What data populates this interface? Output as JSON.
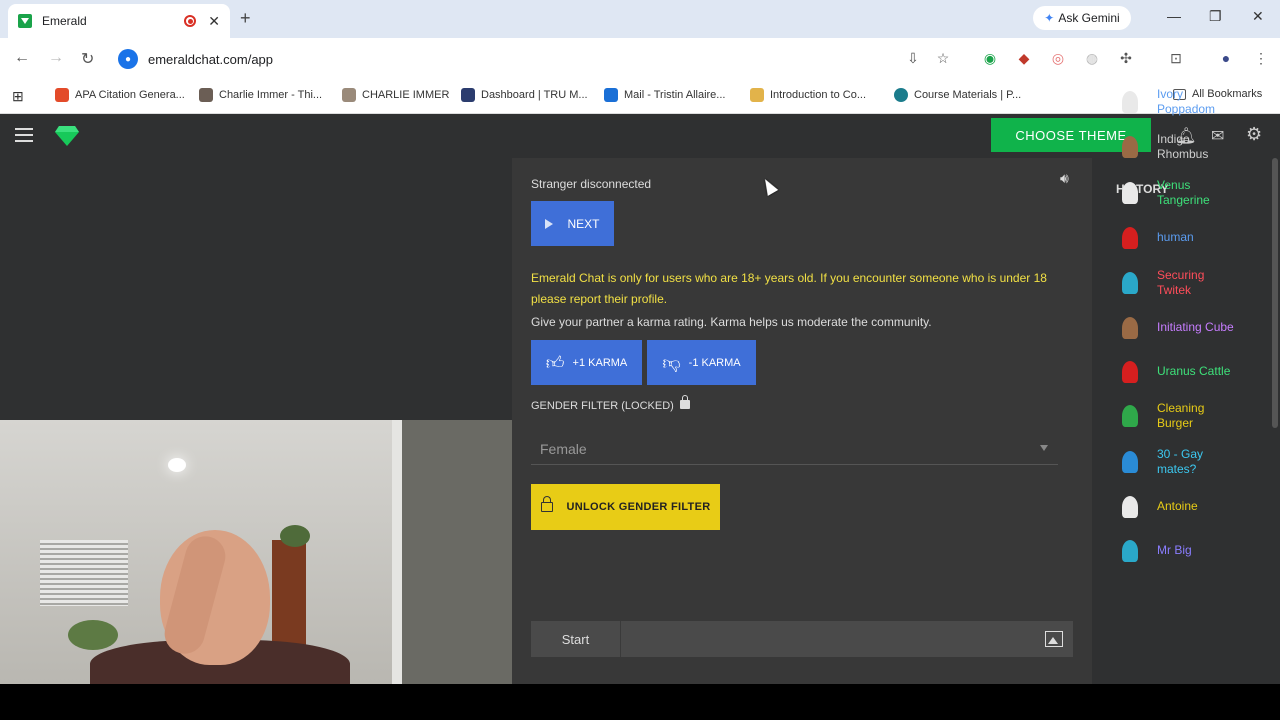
{
  "browser": {
    "tab_title": "Emerald",
    "new_tab": "+",
    "ask_gemini": "Ask Gemini",
    "url": "emeraldchat.com/app",
    "bookmarks": [
      {
        "label": "APA Citation Genera...",
        "color": "#e34b2a"
      },
      {
        "label": "Charlie Immer - Thi...",
        "color": "#6b5e55"
      },
      {
        "label": "CHARLIE IMMER",
        "color": "#9a8a7a"
      },
      {
        "label": "Dashboard | TRU M...",
        "color": "#2b3c6e"
      },
      {
        "label": "Mail - Tristin Allaire...",
        "color": "#1a6fd6"
      },
      {
        "label": "Introduction to Co...",
        "color": "#e2b34a"
      },
      {
        "label": "Course Materials | P...",
        "color": "#1b7c8c"
      }
    ],
    "all_bookmarks": "All Bookmarks"
  },
  "app": {
    "choose_theme": "CHOOSE THEME",
    "status": "Stranger disconnected",
    "next_label": "NEXT",
    "warning": "Emerald Chat is only for users who are 18+ years old. If you encounter someone who is under 18 please report their profile.",
    "karma_info": "Give your partner a karma rating. Karma helps us moderate the community.",
    "plus_karma": "+1 KARMA",
    "minus_karma": "-1 KARMA",
    "gender_filter_label": "GENDER FILTER (LOCKED)",
    "gender_selected": "Female",
    "unlock_label": "UNLOCK GENDER FILTER",
    "start_label": "Start",
    "colors": {
      "accent_green": "#10b34b",
      "primary_blue": "#3f6fd8",
      "warning_yellow": "#f1e045",
      "unlock_yellow": "#e8cc16"
    }
  },
  "history": {
    "title": "HISTORY",
    "items": [
      {
        "name": "Ivory\nPoppadom",
        "color": "#5b9cf0",
        "avatar": "#e9e9e9"
      },
      {
        "name": "Indigo\nRhombus",
        "color": "#cfcfcf",
        "avatar": "#9a6a45"
      },
      {
        "name": "Venus\nTangerine",
        "color": "#3ee07a",
        "avatar": "#e9e9e9"
      },
      {
        "name": "human",
        "color": "#5b9cf0",
        "avatar": "#d61f1f"
      },
      {
        "name": "Securing\nTwitek",
        "color": "#ff4d5a",
        "avatar": "#2aa8c9"
      },
      {
        "name": "Initiating Cube",
        "color": "#c77dff",
        "avatar": "#9a6a45"
      },
      {
        "name": "Uranus Cattle",
        "color": "#3ee07a",
        "avatar": "#d61f1f"
      },
      {
        "name": "Cleaning\nBurger",
        "color": "#e8cc16",
        "avatar": "#2fa84a"
      },
      {
        "name": "30 - Gay\nmates?",
        "color": "#3cc8f0",
        "avatar": "#2a8bd6"
      },
      {
        "name": "Antoine",
        "color": "#e8cc16",
        "avatar": "#e9e9e9"
      },
      {
        "name": "Mr Big",
        "color": "#8a7dff",
        "avatar": "#2aa8c9"
      }
    ]
  }
}
